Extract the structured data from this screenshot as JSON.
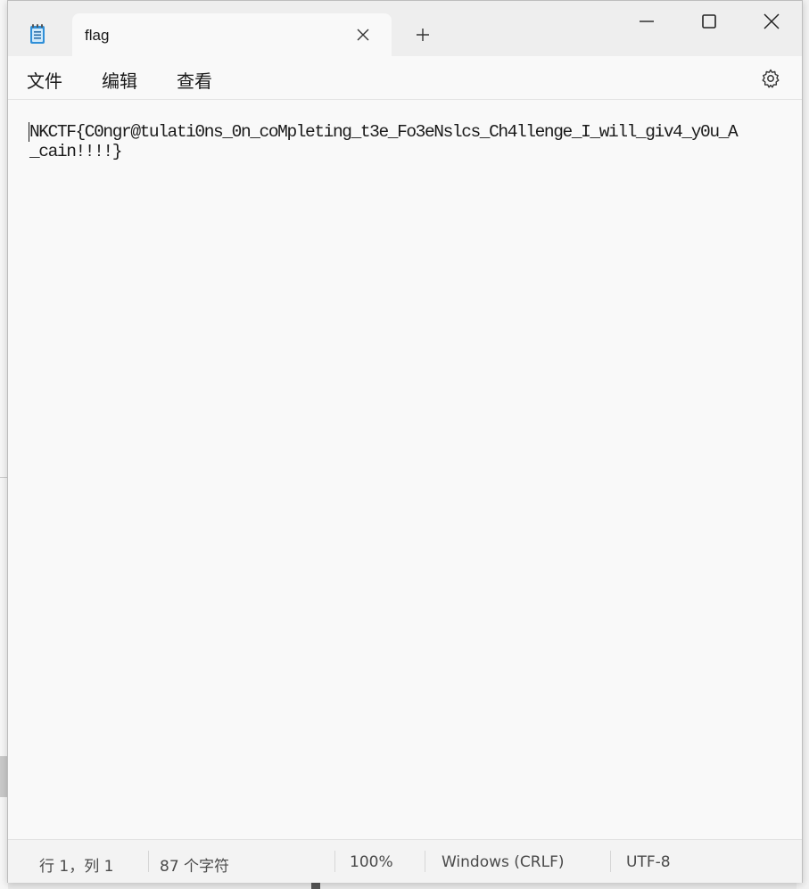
{
  "window": {
    "tab_title": "flag",
    "app_icon": "notepad-icon",
    "controls": [
      "minimize-icon",
      "maximize-icon",
      "close-icon"
    ]
  },
  "menu": {
    "file": "文件",
    "edit": "编辑",
    "view": "查看",
    "settings_icon": "gear-icon"
  },
  "editor": {
    "text": "NKCTF{C0ngr@tulati0ns_0n_coMpleting_t3e_Fo3eNslcs_Ch4llenge_I_will_giv4_y0u_A_cain!!!!}"
  },
  "statusbar": {
    "position": "行 1，列 1",
    "char_count": "87 个字符",
    "zoom": "100%",
    "line_ending": "Windows (CRLF)",
    "encoding": "UTF-8"
  }
}
